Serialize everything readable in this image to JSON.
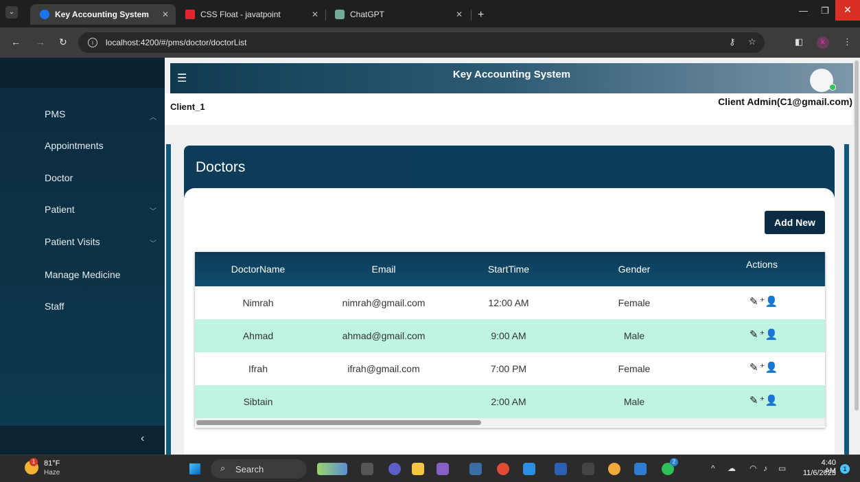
{
  "browser": {
    "tabs": [
      {
        "label": "Key Accounting System",
        "active": true
      },
      {
        "label": "CSS Float - javatpoint",
        "active": false
      },
      {
        "label": "ChatGPT",
        "active": false
      }
    ],
    "url": "localhost:4200/#/pms/doctor/doctorList",
    "profile_initial": "k"
  },
  "app": {
    "title": "Key Accounting System",
    "client": "Client_1",
    "user": "Client Admin(C1@gmail.com)"
  },
  "sidebar": {
    "items": [
      {
        "label": "PMS",
        "has_chevron": "up"
      },
      {
        "label": "Appointments"
      },
      {
        "label": "Doctor"
      },
      {
        "label": "Patient",
        "has_chevron": "down"
      },
      {
        "label": "Patient Visits",
        "has_chevron": "down"
      },
      {
        "label": "Manage Medicine"
      },
      {
        "label": "Staff"
      }
    ]
  },
  "page": {
    "title": "Doctors",
    "add_button": "Add New"
  },
  "table": {
    "columns": [
      "DoctorName",
      "Email",
      "StartTime",
      "Gender",
      "Actions"
    ],
    "rows": [
      [
        "Nimrah",
        "nimrah@gmail.com",
        "12:00 AM",
        "Female"
      ],
      [
        "Ahmad",
        "ahmad@gmail.com",
        "9:00 AM",
        "Male"
      ],
      [
        "Ifrah",
        "ifrah@gmail.com",
        "7:00 PM",
        "Female"
      ],
      [
        "Sibtain",
        "",
        "2:00 AM",
        "Male"
      ]
    ]
  },
  "taskbar": {
    "temperature": "81°F",
    "weather": "Haze",
    "weather_badge": "1",
    "search": "Search",
    "time": "4:40 AM",
    "date": "11/6/2023",
    "notification_count": "1",
    "whatsapp_badge": "2"
  },
  "colors": {
    "sidebar": "#0b2b3f",
    "header": "#0f3a52",
    "row_alt": "#bff4e1",
    "button": "#0a2c45"
  }
}
